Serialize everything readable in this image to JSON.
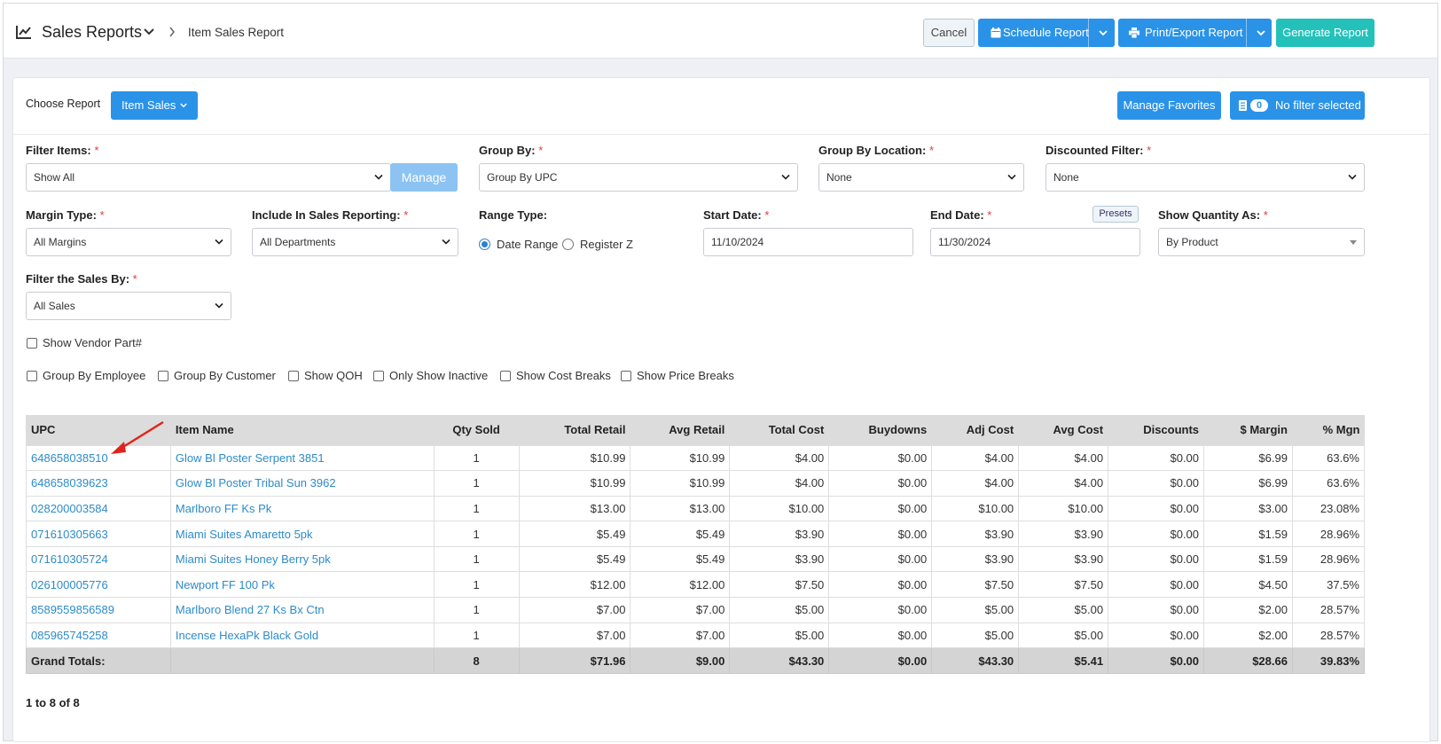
{
  "header": {
    "title": "Sales Reports",
    "subtitle": "Item Sales Report",
    "buttons": {
      "cancel": "Cancel",
      "schedule": "Schedule Report",
      "print": "Print/Export Report",
      "generate": "Generate Report"
    }
  },
  "toolbar": {
    "choose_label": "Choose Report",
    "report_select": "Item Sales",
    "manage_favorites": "Manage Favorites",
    "filter_count": "0",
    "filter_status": "No filter selected"
  },
  "filters": {
    "filter_items": {
      "label": "Filter Items:",
      "value": "Show All",
      "manage": "Manage"
    },
    "group_by": {
      "label": "Group By:",
      "value": "Group By UPC"
    },
    "group_by_location": {
      "label": "Group By Location:",
      "value": "None"
    },
    "discounted_filter": {
      "label": "Discounted Filter:",
      "value": "None"
    },
    "margin_type": {
      "label": "Margin Type:",
      "value": "All Margins"
    },
    "include_in_sales": {
      "label": "Include In Sales Reporting:",
      "value": "All Departments"
    },
    "range_type": {
      "label": "Range Type:",
      "option1": "Date Range",
      "option2": "Register Z",
      "selected": "Date Range"
    },
    "start_date": {
      "label": "Start Date:",
      "value": "11/10/2024"
    },
    "end_date": {
      "label": "End Date:",
      "value": "11/30/2024",
      "presets": "Presets"
    },
    "show_quantity": {
      "label": "Show Quantity As:",
      "value": "By Product"
    },
    "filter_sales_by": {
      "label": "Filter the Sales By:",
      "value": "All Sales"
    },
    "required_mark": "*"
  },
  "options": {
    "vendor_part": "Show Vendor Part#",
    "group_by_employee": "Group By Employee",
    "group_by_customer": "Group By Customer",
    "show_qoh": "Show QOH",
    "only_inactive": "Only Show Inactive",
    "cost_breaks": "Show Cost Breaks",
    "price_breaks": "Show Price Breaks"
  },
  "table": {
    "columns": [
      "UPC",
      "Item Name",
      "Qty Sold",
      "Total Retail",
      "Avg Retail",
      "Total Cost",
      "Buydowns",
      "Adj Cost",
      "Avg Cost",
      "Discounts",
      "$ Margin",
      "% Mgn"
    ],
    "rows": [
      [
        "648658038510",
        "Glow Bl Poster Serpent 3851",
        "1",
        "$10.99",
        "$10.99",
        "$4.00",
        "$0.00",
        "$4.00",
        "$4.00",
        "$0.00",
        "$6.99",
        "63.6%"
      ],
      [
        "648658039623",
        "Glow Bl Poster Tribal Sun 3962",
        "1",
        "$10.99",
        "$10.99",
        "$4.00",
        "$0.00",
        "$4.00",
        "$4.00",
        "$0.00",
        "$6.99",
        "63.6%"
      ],
      [
        "028200003584",
        "Marlboro FF Ks Pk",
        "1",
        "$13.00",
        "$13.00",
        "$10.00",
        "$0.00",
        "$10.00",
        "$10.00",
        "$0.00",
        "$3.00",
        "23.08%"
      ],
      [
        "071610305663",
        "Miami Suites Amaretto 5pk",
        "1",
        "$5.49",
        "$5.49",
        "$3.90",
        "$0.00",
        "$3.90",
        "$3.90",
        "$0.00",
        "$1.59",
        "28.96%"
      ],
      [
        "071610305724",
        "Miami Suites Honey Berry 5pk",
        "1",
        "$5.49",
        "$5.49",
        "$3.90",
        "$0.00",
        "$3.90",
        "$3.90",
        "$0.00",
        "$1.59",
        "28.96%"
      ],
      [
        "026100005776",
        "Newport FF 100 Pk",
        "1",
        "$12.00",
        "$12.00",
        "$7.50",
        "$0.00",
        "$7.50",
        "$7.50",
        "$0.00",
        "$4.50",
        "37.5%"
      ],
      [
        "8589559856589",
        "Marlboro Blend 27 Ks Bx Ctn",
        "1",
        "$7.00",
        "$7.00",
        "$5.00",
        "$0.00",
        "$5.00",
        "$5.00",
        "$0.00",
        "$2.00",
        "28.57%"
      ],
      [
        "085965745258",
        "Incense HexaPk Black Gold",
        "1",
        "$7.00",
        "$7.00",
        "$5.00",
        "$0.00",
        "$5.00",
        "$5.00",
        "$0.00",
        "$2.00",
        "28.57%"
      ]
    ],
    "totals": [
      "Grand Totals:",
      "",
      "8",
      "$71.96",
      "$9.00",
      "$43.30",
      "$0.00",
      "$43.30",
      "$5.41",
      "$0.00",
      "$28.66",
      "39.83%"
    ]
  },
  "pager": "1 to 8 of 8",
  "colors": {
    "primary": "#2a93e8",
    "teal": "#24c1bb",
    "link": "#2d8bc9",
    "arrow": "#e2231a"
  }
}
